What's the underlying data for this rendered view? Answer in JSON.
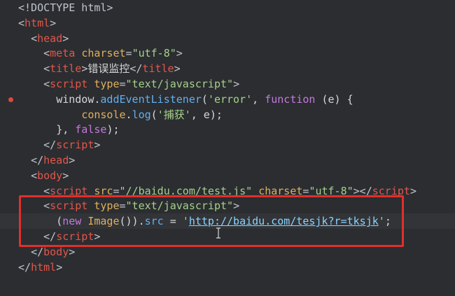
{
  "editor": {
    "breakpoint_line": 7,
    "current_line": 15,
    "lines": [
      {
        "indent": "",
        "tokens": [
          {
            "t": "punc",
            "v": "<!DOCTYPE html>"
          }
        ]
      },
      {
        "indent": "",
        "tokens": [
          {
            "t": "punc",
            "v": "<"
          },
          {
            "t": "tag",
            "v": "html"
          },
          {
            "t": "punc",
            "v": ">"
          }
        ]
      },
      {
        "indent": "  ",
        "tokens": [
          {
            "t": "punc",
            "v": "<"
          },
          {
            "t": "tag",
            "v": "head"
          },
          {
            "t": "punc",
            "v": ">"
          }
        ]
      },
      {
        "indent": "    ",
        "tokens": [
          {
            "t": "punc",
            "v": "<"
          },
          {
            "t": "tag",
            "v": "meta"
          },
          {
            "t": "plain",
            "v": " "
          },
          {
            "t": "attr",
            "v": "charset"
          },
          {
            "t": "punc",
            "v": "="
          },
          {
            "t": "str",
            "v": "\"utf-8\""
          },
          {
            "t": "punc",
            "v": ">"
          }
        ]
      },
      {
        "indent": "    ",
        "tokens": [
          {
            "t": "punc",
            "v": "<"
          },
          {
            "t": "tag",
            "v": "title"
          },
          {
            "t": "punc",
            "v": ">"
          },
          {
            "t": "plain",
            "v": "错误监控"
          },
          {
            "t": "punc",
            "v": "</"
          },
          {
            "t": "tag",
            "v": "title"
          },
          {
            "t": "punc",
            "v": ">"
          }
        ]
      },
      {
        "indent": "    ",
        "tokens": [
          {
            "t": "punc",
            "v": "<"
          },
          {
            "t": "tag",
            "v": "script"
          },
          {
            "t": "plain",
            "v": " "
          },
          {
            "t": "attr",
            "v": "type"
          },
          {
            "t": "punc",
            "v": "="
          },
          {
            "t": "str",
            "v": "\"text/javascript\""
          },
          {
            "t": "punc",
            "v": ">"
          }
        ]
      },
      {
        "indent": "      ",
        "tokens": [
          {
            "t": "plain",
            "v": "window."
          },
          {
            "t": "fn",
            "v": "addEventListener"
          },
          {
            "t": "plain",
            "v": "("
          },
          {
            "t": "str",
            "v": "'error'"
          },
          {
            "t": "plain",
            "v": ", "
          },
          {
            "t": "kw",
            "v": "function"
          },
          {
            "t": "plain",
            "v": " (e) {"
          }
        ]
      },
      {
        "indent": "          ",
        "tokens": [
          {
            "t": "attr",
            "v": "console"
          },
          {
            "t": "plain",
            "v": "."
          },
          {
            "t": "fn",
            "v": "log"
          },
          {
            "t": "plain",
            "v": "("
          },
          {
            "t": "str",
            "v": "'捕获'"
          },
          {
            "t": "plain",
            "v": ", e);"
          }
        ]
      },
      {
        "indent": "      ",
        "tokens": [
          {
            "t": "plain",
            "v": "}, "
          },
          {
            "t": "kw",
            "v": "false"
          },
          {
            "t": "plain",
            "v": ");"
          }
        ]
      },
      {
        "indent": "    ",
        "tokens": [
          {
            "t": "punc",
            "v": "</"
          },
          {
            "t": "tag",
            "v": "script"
          },
          {
            "t": "punc",
            "v": ">"
          }
        ]
      },
      {
        "indent": "  ",
        "tokens": [
          {
            "t": "punc",
            "v": "</"
          },
          {
            "t": "tag",
            "v": "head"
          },
          {
            "t": "punc",
            "v": ">"
          }
        ]
      },
      {
        "indent": "  ",
        "tokens": [
          {
            "t": "punc",
            "v": "<"
          },
          {
            "t": "tag",
            "v": "body"
          },
          {
            "t": "punc",
            "v": ">"
          }
        ]
      },
      {
        "indent": "    ",
        "tokens": [
          {
            "t": "punc",
            "v": "<"
          },
          {
            "t": "tag",
            "v": "script"
          },
          {
            "t": "plain",
            "v": " "
          },
          {
            "t": "attr",
            "v": "src"
          },
          {
            "t": "punc",
            "v": "="
          },
          {
            "t": "str",
            "v": "\"//baidu.com/test.js\""
          },
          {
            "t": "plain",
            "v": " "
          },
          {
            "t": "attr",
            "v": "charset"
          },
          {
            "t": "punc",
            "v": "="
          },
          {
            "t": "str",
            "v": "\"utf-8\""
          },
          {
            "t": "punc",
            "v": "></"
          },
          {
            "t": "tag",
            "v": "script"
          },
          {
            "t": "punc",
            "v": ">"
          }
        ]
      },
      {
        "indent": "    ",
        "tokens": [
          {
            "t": "punc",
            "v": "<"
          },
          {
            "t": "tag",
            "v": "script"
          },
          {
            "t": "plain",
            "v": " "
          },
          {
            "t": "attr",
            "v": "type"
          },
          {
            "t": "punc",
            "v": "="
          },
          {
            "t": "str",
            "v": "\"text/javascript\""
          },
          {
            "t": "punc",
            "v": ">"
          }
        ]
      },
      {
        "indent": "      ",
        "tokens": [
          {
            "t": "plain",
            "v": "("
          },
          {
            "t": "kw",
            "v": "new"
          },
          {
            "t": "plain",
            "v": " "
          },
          {
            "t": "attr",
            "v": "Image"
          },
          {
            "t": "plain",
            "v": "())."
          },
          {
            "t": "fn",
            "v": "src"
          },
          {
            "t": "plain",
            "v": " = "
          },
          {
            "t": "str",
            "v": "'"
          },
          {
            "t": "url",
            "v": "http://baidu.com/tesjk?r=tksjk"
          },
          {
            "t": "str",
            "v": "'"
          },
          {
            "t": "plain",
            "v": ";"
          }
        ]
      },
      {
        "indent": "    ",
        "tokens": [
          {
            "t": "punc",
            "v": "</"
          },
          {
            "t": "tag",
            "v": "script"
          },
          {
            "t": "punc",
            "v": ">"
          }
        ]
      },
      {
        "indent": "  ",
        "tokens": [
          {
            "t": "punc",
            "v": "</"
          },
          {
            "t": "tag",
            "v": "body"
          },
          {
            "t": "punc",
            "v": ">"
          }
        ]
      },
      {
        "indent": "",
        "tokens": [
          {
            "t": "punc",
            "v": "</"
          },
          {
            "t": "tag",
            "v": "html"
          },
          {
            "t": "punc",
            "v": ">"
          }
        ]
      }
    ]
  },
  "colors": {
    "background": "#2b2d31",
    "highlight_border": "#e0302c",
    "breakpoint": "#e0483d",
    "tag": "#e45649",
    "attribute": "#e0b15c",
    "string": "#a6d189",
    "keyword": "#c678dd",
    "function": "#61afef"
  }
}
